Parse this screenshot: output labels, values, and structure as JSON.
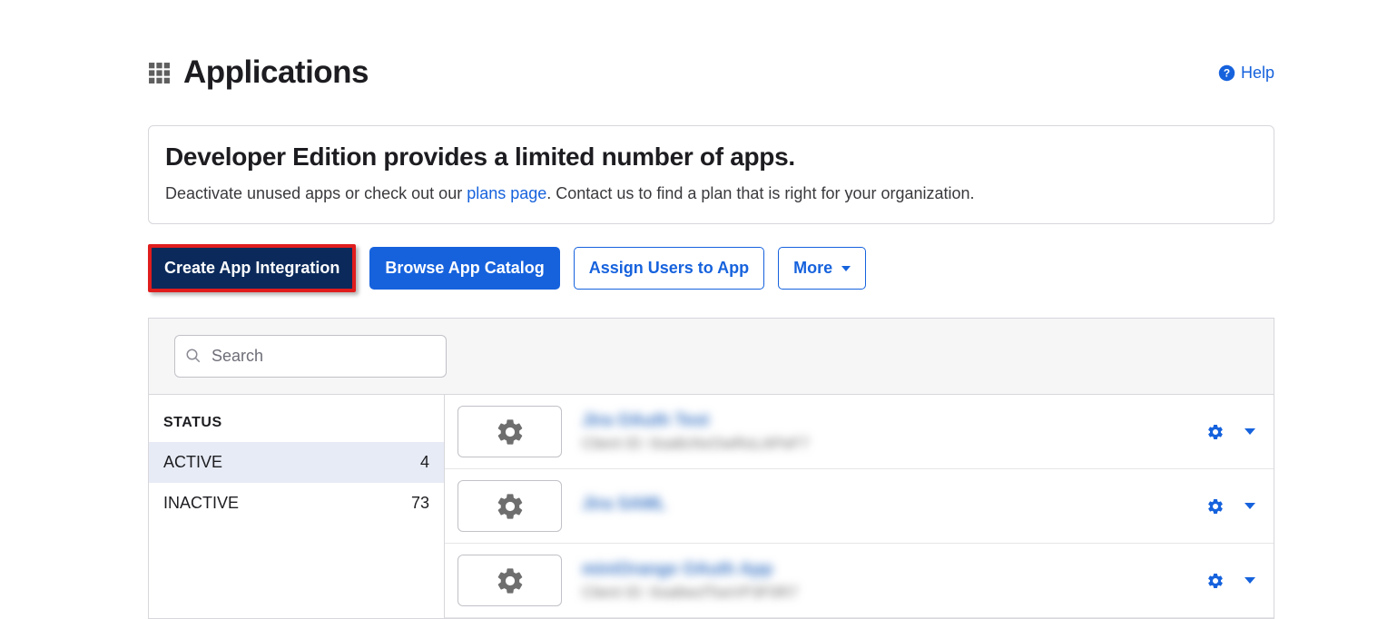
{
  "header": {
    "title": "Applications",
    "help_label": "Help"
  },
  "banner": {
    "title": "Developer Edition provides a limited number of apps.",
    "pre_text": "Deactivate unused apps or check out our ",
    "link_text": "plans page",
    "post_text": ". Contact us to find a plan that is right for your organization."
  },
  "actions": {
    "create": "Create App Integration",
    "browse": "Browse App Catalog",
    "assign": "Assign Users to App",
    "more": "More"
  },
  "search": {
    "placeholder": "Search"
  },
  "sidebar": {
    "status_header": "STATUS",
    "items": [
      {
        "label": "ACTIVE",
        "count": "4",
        "selected": true
      },
      {
        "label": "INACTIVE",
        "count": "73",
        "selected": false
      }
    ]
  },
  "apps": [
    {
      "name": "Jira OAuth Test",
      "sub": "Client ID: 0oa8cNvOwRoLAPeF7"
    },
    {
      "name": "Jira SAML",
      "sub": ""
    },
    {
      "name": "miniOrange OAuth App",
      "sub": "Client ID: 0oa8wcfTseVP3F0R7"
    }
  ]
}
